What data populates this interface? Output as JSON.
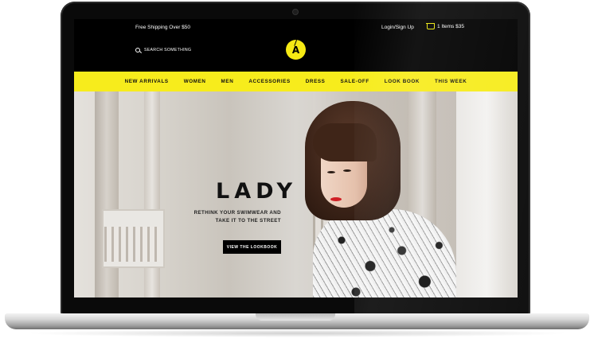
{
  "header": {
    "shipping_text": "Free Shipping Over $50",
    "login_text": "Login/Sign Up",
    "cart_text": "1 Items $35",
    "search_placeholder": "SEARCH SOMETHING",
    "logo_letter": "A"
  },
  "nav": {
    "items": [
      "NEW ARRIVALS",
      "WOMEN",
      "MEN",
      "ACCESSORIES",
      "DRESS",
      "SALE-OFF",
      "LOOK BOOK",
      "THIS WEEK"
    ]
  },
  "hero": {
    "title": "LADY",
    "subtitle": "RETHINK YOUR SWIMWEAR AND TAKE IT TO THE STREET",
    "button_label": "VIEW THE LOOKBOOK"
  },
  "colors": {
    "accent_yellow": "#f7ec1c",
    "header_black": "#000000"
  },
  "icons": [
    "search-icon",
    "cart-icon",
    "logo-badge"
  ]
}
